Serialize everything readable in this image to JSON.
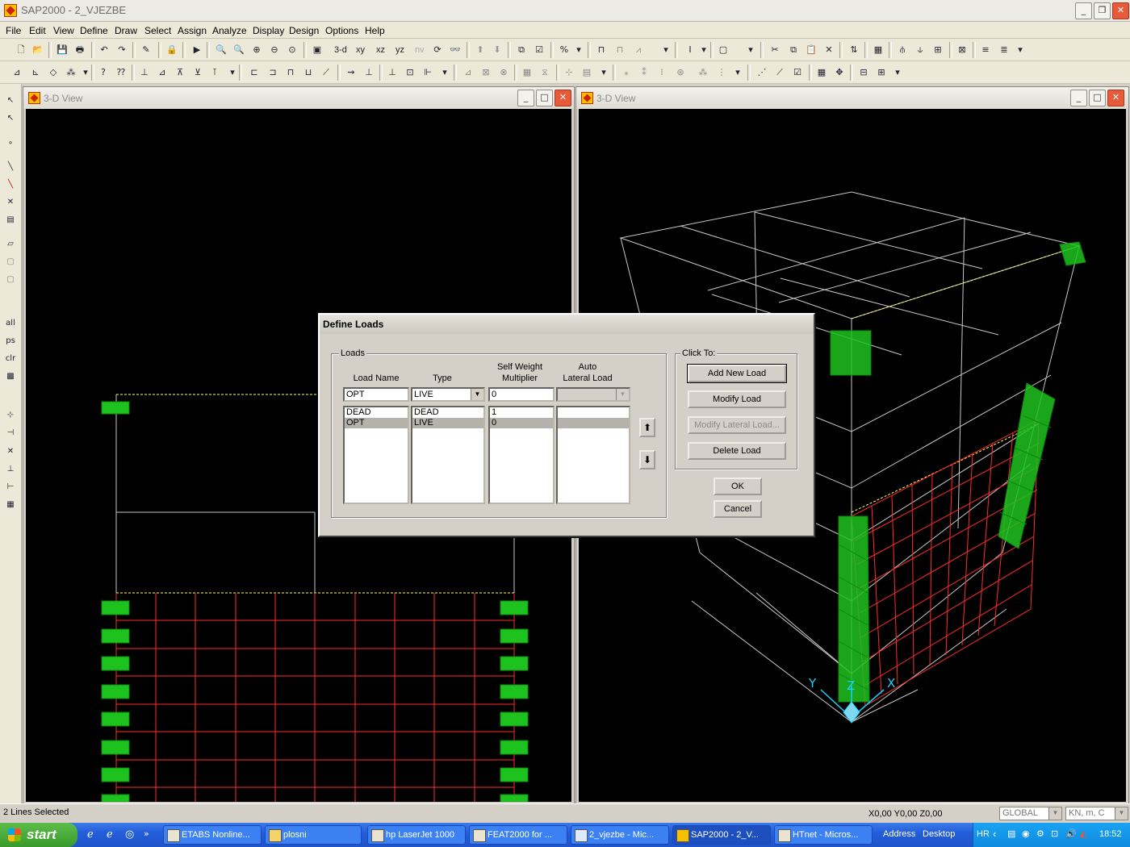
{
  "app": {
    "title": "SAP2000 - 2_VJEZBE"
  },
  "menu": [
    "File",
    "Edit",
    "View",
    "Define",
    "Draw",
    "Select",
    "Assign",
    "Analyze",
    "Display",
    "Design",
    "Options",
    "Help"
  ],
  "toolbar1": {
    "view_3d": "3-d",
    "view_xy": "xy",
    "view_xz": "xz",
    "view_yz": "yz",
    "view_nv": "nv"
  },
  "leftbar": {
    "all": "all",
    "ps": "ps",
    "clr": "clr"
  },
  "left_window": {
    "title": "3-D View"
  },
  "right_window": {
    "title": "3-D View"
  },
  "dialog": {
    "title": "Define Loads",
    "loads_group": "Loads",
    "click_to_group": "Click To:",
    "col_load_name": "Load Name",
    "col_type": "Type",
    "col_self_weight_1": "Self Weight",
    "col_self_weight_2": "Multiplier",
    "col_auto_1": "Auto",
    "col_auto_2": "Lateral Load",
    "input_load_name": "OPT",
    "input_type": "LIVE",
    "input_multiplier": "0",
    "rows": [
      {
        "name": "DEAD",
        "type": "DEAD",
        "multiplier": "1"
      },
      {
        "name": "OPT",
        "type": "LIVE",
        "multiplier": "0"
      }
    ],
    "btn_add": "Add New Load",
    "btn_modify": "Modify Load",
    "btn_modify_lateral": "Modify Lateral Load...",
    "btn_delete": "Delete Load",
    "btn_ok": "OK",
    "btn_cancel": "Cancel"
  },
  "axes": {
    "x": "X",
    "y": "Y",
    "z": "Z"
  },
  "status": {
    "selection": "2 Lines Selected",
    "coords": "X0,00  Y0,00  Z0,00",
    "coord_system": "GLOBAL",
    "units": "KN, m, C"
  },
  "taskbar": {
    "start": "start",
    "tasks": [
      "ETABS Nonline...",
      "plosni",
      "hp LaserJet 1000",
      "FEAT2000 for ...",
      "2_vjezbe - Mic...",
      "SAP2000 - 2_V...",
      "HTnet - Micros..."
    ],
    "address": "Address",
    "desktop": "Desktop",
    "lang": "HR",
    "clock": "18:52"
  },
  "colors": {
    "grid_red": "#ff2a2a",
    "support_green": "#1ec21e",
    "frame_grey": "#c8c8c8",
    "axis_cyan": "#1ad0ff"
  }
}
